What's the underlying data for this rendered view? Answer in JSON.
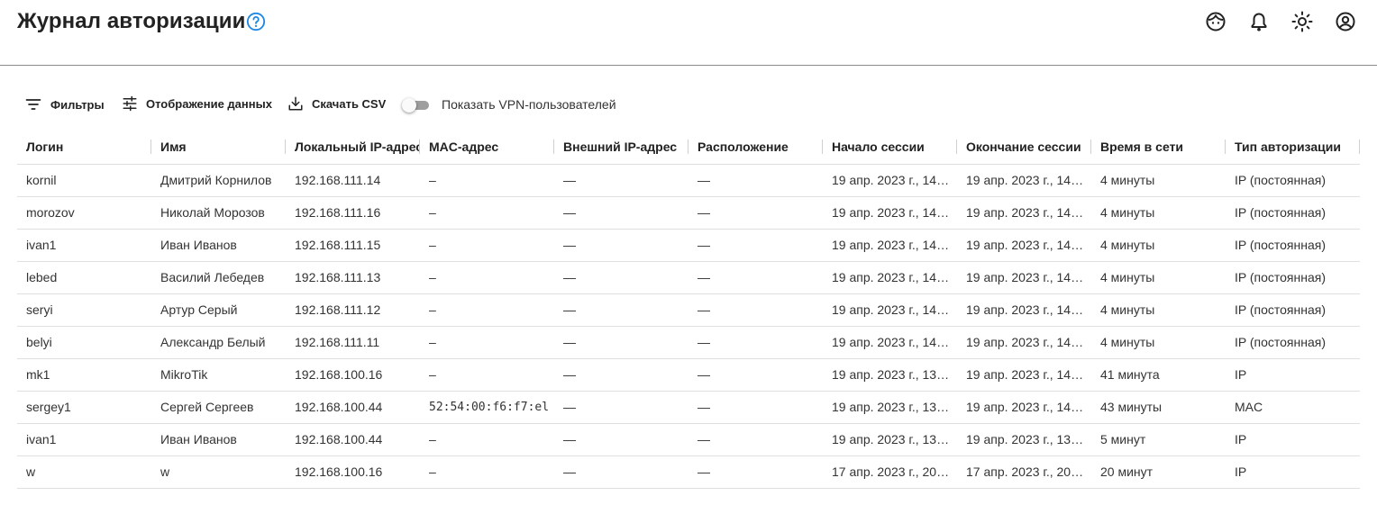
{
  "header": {
    "title": "Журнал авторизации",
    "icons": [
      "help-icon",
      "support-icon",
      "bell-icon",
      "sun-icon",
      "account-icon"
    ]
  },
  "toolbar": {
    "filters_label": "Фильтры",
    "display_label": "Отображение данных",
    "csv_label": "Скачать CSV",
    "vpn_toggle_label": "Показать VPN-пользователей",
    "vpn_toggle_on": false
  },
  "table": {
    "columns": [
      "Логин",
      "Имя",
      "Локальный IP-адрес",
      "MAC-адрес",
      "Внешний IP-адрес",
      "Расположение",
      "Начало сессии",
      "Окончание сессии",
      "Время в сети",
      "Тип авторизации"
    ],
    "rows": [
      [
        "kornil",
        "Дмитрий Корнилов",
        "192.168.111.14",
        "–",
        "—",
        "—",
        "19 апр. 2023 г., 14…",
        "19 апр. 2023 г., 14…",
        "4 минуты",
        "IP (постоянная)"
      ],
      [
        "morozov",
        "Николай Морозов",
        "192.168.111.16",
        "–",
        "—",
        "—",
        "19 апр. 2023 г., 14…",
        "19 апр. 2023 г., 14…",
        "4 минуты",
        "IP (постоянная)"
      ],
      [
        "ivan1",
        "Иван Иванов",
        "192.168.111.15",
        "–",
        "—",
        "—",
        "19 апр. 2023 г., 14…",
        "19 апр. 2023 г., 14…",
        "4 минуты",
        "IP (постоянная)"
      ],
      [
        "lebed",
        "Василий Лебедев",
        "192.168.111.13",
        "–",
        "—",
        "—",
        "19 апр. 2023 г., 14…",
        "19 апр. 2023 г., 14…",
        "4 минуты",
        "IP (постоянная)"
      ],
      [
        "seryi",
        "Артур Серый",
        "192.168.111.12",
        "–",
        "—",
        "—",
        "19 апр. 2023 г., 14…",
        "19 апр. 2023 г., 14…",
        "4 минуты",
        "IP (постоянная)"
      ],
      [
        "belyi",
        "Александр Белый",
        "192.168.111.11",
        "–",
        "—",
        "—",
        "19 апр. 2023 г., 14…",
        "19 апр. 2023 г., 14…",
        "4 минуты",
        "IP (постоянная)"
      ],
      [
        "mk1",
        "MikroTik",
        "192.168.100.16",
        "–",
        "—",
        "—",
        "19 апр. 2023 г., 13…",
        "19 апр. 2023 г., 14…",
        "41 минута",
        "IP"
      ],
      [
        "sergey1",
        "Сергей Сергеев",
        "192.168.100.44",
        "52:54:00:f6:f7:el",
        "—",
        "—",
        "19 апр. 2023 г., 13…",
        "19 апр. 2023 г., 14…",
        "43 минуты",
        "MAC"
      ],
      [
        "ivan1",
        "Иван Иванов",
        "192.168.100.44",
        "–",
        "—",
        "—",
        "19 апр. 2023 г., 13…",
        "19 апр. 2023 г., 13…",
        "5 минут",
        "IP"
      ],
      [
        "w",
        "w",
        "192.168.100.16",
        "–",
        "—",
        "—",
        "17 апр. 2023 г., 20…",
        "17 апр. 2023 г., 20…",
        "20 минут",
        "IP"
      ]
    ]
  },
  "colors": {
    "accent": "#1e88e5",
    "text": "#202124",
    "divider": "#e0e0e0"
  }
}
